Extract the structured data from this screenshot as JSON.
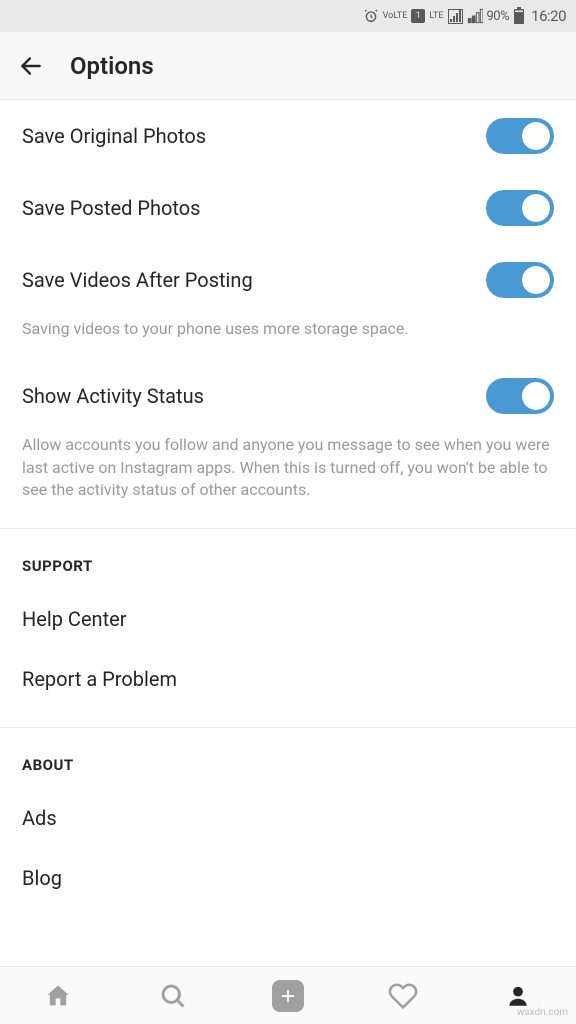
{
  "statusBar": {
    "volte": "VoLTE",
    "sim": "1",
    "lte": "LTE",
    "battery": "90%",
    "time": "16:20"
  },
  "header": {
    "title": "Options"
  },
  "settings": {
    "saveOriginalPhotos": {
      "label": "Save Original Photos",
      "on": true
    },
    "savePostedPhotos": {
      "label": "Save Posted Photos",
      "on": true
    },
    "saveVideos": {
      "label": "Save Videos After Posting",
      "on": true,
      "desc": "Saving videos to your phone uses more storage space."
    },
    "activityStatus": {
      "label": "Show Activity Status",
      "on": true,
      "desc": "Allow accounts you follow and anyone you message to see when you were last active on Instagram apps. When this is turned off, you won't be able to see the activity status of other accounts."
    }
  },
  "sections": {
    "support": {
      "title": "SUPPORT",
      "items": {
        "helpCenter": "Help Center",
        "reportProblem": "Report a Problem"
      }
    },
    "about": {
      "title": "ABOUT",
      "items": {
        "ads": "Ads",
        "blog": "Blog"
      }
    }
  },
  "watermark": "wsxdn.com"
}
